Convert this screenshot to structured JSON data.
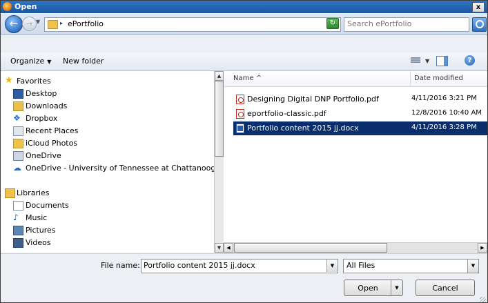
{
  "window": {
    "title": "Open",
    "close_symbol": "x"
  },
  "address": {
    "breadcrumb_arrow": "▸",
    "path": "ePortfolio",
    "search_placeholder": "Search ePortfolio"
  },
  "toolbar": {
    "organize_label": "Organize",
    "new_folder_label": "New folder"
  },
  "nav": {
    "items": [
      {
        "label": "Favorites",
        "icon": "star-icon"
      },
      {
        "label": "Desktop",
        "icon": "desktop-icon"
      },
      {
        "label": "Downloads",
        "icon": "downloads-icon"
      },
      {
        "label": "Dropbox",
        "icon": "dropbox-icon"
      },
      {
        "label": "Recent Places",
        "icon": "recent-places-icon"
      },
      {
        "label": "iCloud Photos",
        "icon": "folder-icon"
      },
      {
        "label": "OneDrive",
        "icon": "onedrive-icon"
      },
      {
        "label": "OneDrive - University of Tennessee at Chattanooga",
        "icon": "cloud-icon"
      },
      {
        "label": "Libraries",
        "icon": "libraries-icon"
      },
      {
        "label": "Documents",
        "icon": "documents-icon"
      },
      {
        "label": "Music",
        "icon": "music-icon"
      },
      {
        "label": "Pictures",
        "icon": "pictures-icon"
      },
      {
        "label": "Videos",
        "icon": "videos-icon"
      }
    ]
  },
  "files": {
    "columns": {
      "name": "Name",
      "name_sort": "^",
      "date": "Date modified"
    },
    "rows": [
      {
        "name": "Designing Digital DNP Portfolio.pdf",
        "date": "4/11/2016 3:21 PM",
        "icon": "pdf-icon",
        "selected": false
      },
      {
        "name": "eportfolio-classic.pdf",
        "date": "12/8/2016 10:40 AM",
        "icon": "pdf-icon",
        "selected": false
      },
      {
        "name": "Portfolio content 2015 jj.docx",
        "date": "4/11/2016 3:28 PM",
        "icon": "docx-icon",
        "selected": true
      }
    ]
  },
  "bottom": {
    "file_name_label": "File name:",
    "file_name_value": "Portfolio content 2015 jj.docx",
    "file_type": "All Files",
    "open_label": "Open",
    "cancel_label": "Cancel"
  },
  "colors": {
    "title_bar": "#1b57a3",
    "selection": "#0a2d6b"
  }
}
